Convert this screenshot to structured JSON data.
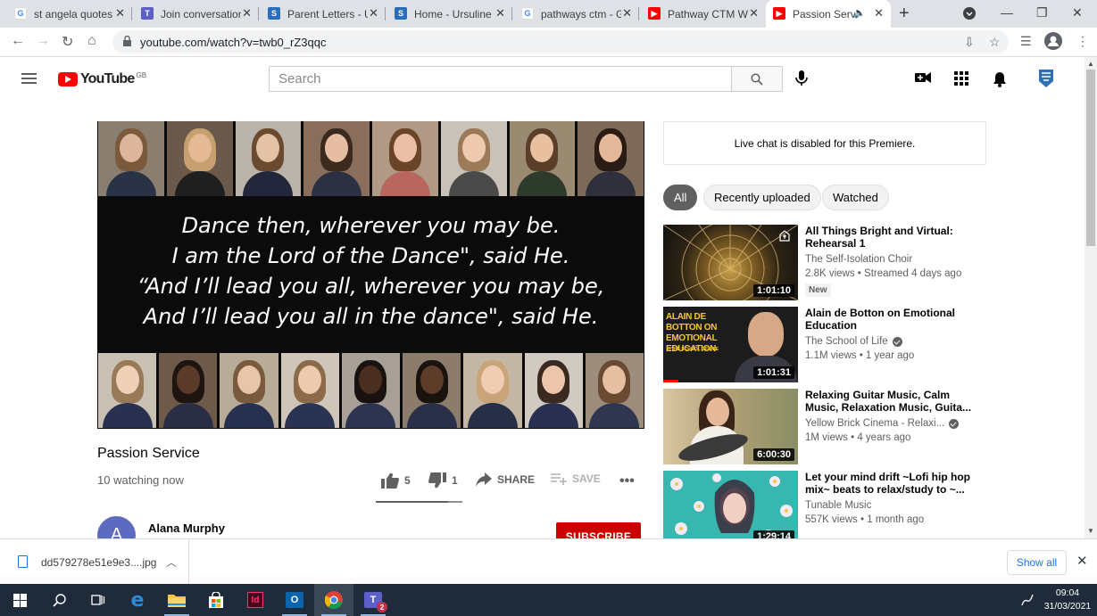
{
  "browser": {
    "tabs": [
      {
        "label": "st angela quotes",
        "icon": "google-icon",
        "color": "#4285f4"
      },
      {
        "label": "Join conversation",
        "icon": "teams-icon",
        "color": "#5b5fc7"
      },
      {
        "label": "Parent Letters - U",
        "icon": "sharepoint-icon",
        "color": "#2a6ebb"
      },
      {
        "label": "Home - Ursuline",
        "icon": "sharepoint-icon",
        "color": "#2a6ebb"
      },
      {
        "label": "pathways ctm - G",
        "icon": "google-icon",
        "color": "#4285f4"
      },
      {
        "label": "Pathway CTM Wo",
        "icon": "youtube-icon",
        "color": "#ff0000"
      },
      {
        "label": "Passion Servi",
        "icon": "youtube-icon",
        "color": "#ff0000"
      }
    ],
    "url": "youtube.com/watch?v=twb0_rZ3qqc"
  },
  "youtube": {
    "logo_text": "YouTube",
    "region": "GB",
    "search_placeholder": "Search"
  },
  "video": {
    "lyrics": [
      "Dance then, wherever you may be.",
      "I am the Lord of the Dance\", said He.",
      "“And I’ll lead you all, wherever you may be,",
      "And I’ll lead you all in the dance\", said He."
    ],
    "title": "Passion Service",
    "watching": "10 watching now",
    "likes": "5",
    "dislikes": "1",
    "share_label": "SHARE",
    "save_label": "SAVE",
    "like_ratio": 0.83
  },
  "channel": {
    "avatar_letter": "A",
    "name": "Alana Murphy",
    "subscribe_label": "SUBSCRIBE"
  },
  "sidebar": {
    "live_chat": "Live chat is disabled for this Premiere.",
    "chips": [
      "All",
      "Recently uploaded",
      "Watched"
    ],
    "recommendations": [
      {
        "title": "All Things Bright and Virtual: Rehearsal 1",
        "channel": "The Self-Isolation Choir",
        "meta": "2.8K views • Streamed 4 days ago",
        "badge": "New",
        "duration": "1:01:10",
        "verified": false
      },
      {
        "title": "Alain de Botton on Emotional Education",
        "channel": "The School of Life",
        "meta": "1.1M views • 1 year ago",
        "badge": "",
        "duration": "1:01:31",
        "verified": true,
        "thumb_text": "ALAIN DE BOTTON ON EMOTIONAL EDUCATION",
        "thumb_sub": "@THE SCHOOL OF LIFE",
        "watched": 0.11
      },
      {
        "title": "Relaxing Guitar Music, Calm Music, Relaxation Music, Guita...",
        "channel": "Yellow Brick Cinema - Relaxi...",
        "meta": "1M views • 4 years ago",
        "badge": "",
        "duration": "6:00:30",
        "verified": true
      },
      {
        "title": "Let your mind drift ~Lofi hip hop mix~ beats to relax/study to ~...",
        "channel": "Tunable Music",
        "meta": "557K views • 1 month ago",
        "badge": "",
        "duration": "1:29:14",
        "verified": false
      }
    ]
  },
  "downloads": {
    "file": "dd579278e51e9e3....jpg",
    "show_all": "Show all"
  },
  "taskbar": {
    "time": "09:04",
    "date": "31/03/2021",
    "teams_badge": "2"
  }
}
